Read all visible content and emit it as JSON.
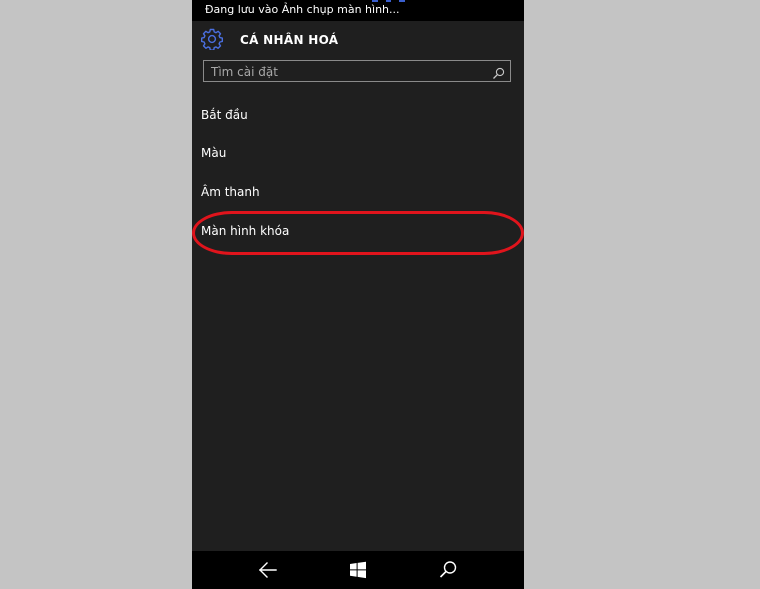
{
  "status_bar": {
    "notification": "Đang lưu vào Ảnh chụp màn hình..."
  },
  "header": {
    "icon": "gear-icon",
    "title": "CÁ NHÂN HOÁ"
  },
  "search": {
    "placeholder": "Tìm cài đặt",
    "icon": "search-icon"
  },
  "menu": {
    "items": [
      {
        "label": "Bắt đầu"
      },
      {
        "label": "Màu"
      },
      {
        "label": "Âm thanh"
      },
      {
        "label": "Màn hình khóa",
        "highlighted": true
      }
    ]
  },
  "nav_bar": {
    "back_icon": "back-arrow-icon",
    "home_icon": "windows-logo-icon",
    "search_icon": "search-icon"
  },
  "colors": {
    "accent": "#3a5fcf",
    "highlight": "#e0141c",
    "panel_background": "#1f1f1f",
    "page_background": "#c4c4c4"
  }
}
